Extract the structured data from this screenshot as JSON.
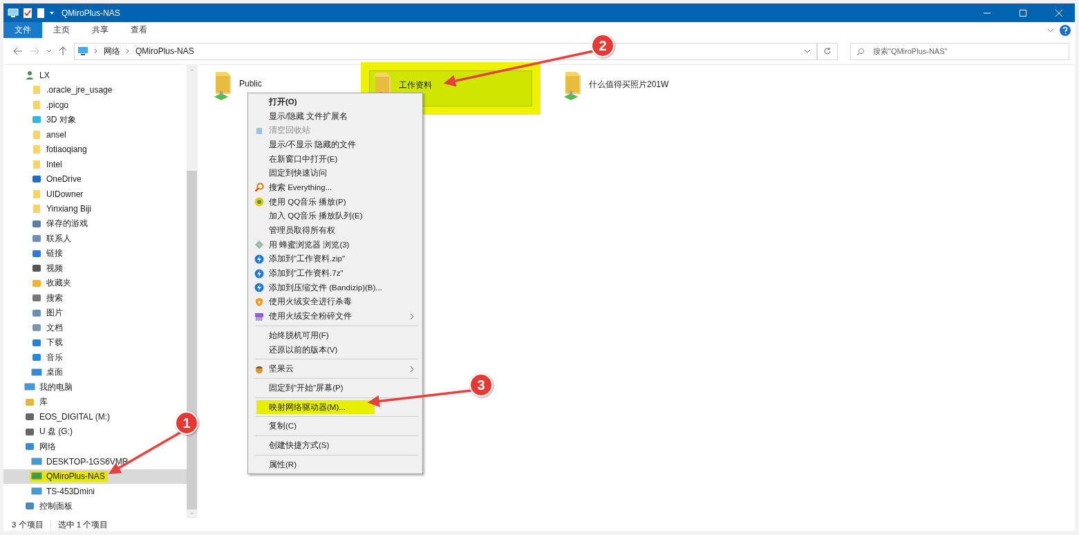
{
  "window": {
    "title": "QMiroPlus-NAS"
  },
  "ribbon_tabs": [
    {
      "label": "文件",
      "selected": true
    },
    {
      "label": "主页",
      "selected": false
    },
    {
      "label": "共享",
      "selected": false
    },
    {
      "label": "查看",
      "selected": false
    }
  ],
  "address_bar": {
    "crumbs": [
      "网络",
      "QMiroPlus-NAS"
    ]
  },
  "search": {
    "placeholder": "搜索\"QMiroPlus-NAS\""
  },
  "sidebar": {
    "items": [
      {
        "label": "LX",
        "selected": false,
        "highlighted": false,
        "children": [
          {
            "label": ".oracle_jre_usage",
            "selected": false,
            "highlighted": false
          },
          {
            "label": ".picgo",
            "selected": false,
            "highlighted": false
          },
          {
            "label": "3D 对象",
            "selected": false,
            "highlighted": false
          },
          {
            "label": "ansel",
            "selected": false,
            "highlighted": false
          },
          {
            "label": "fotiaoqiang",
            "selected": false,
            "highlighted": false
          },
          {
            "label": "Intel",
            "selected": false,
            "highlighted": false
          },
          {
            "label": "OneDrive",
            "selected": false,
            "highlighted": false
          },
          {
            "label": "UIDowner",
            "selected": false,
            "highlighted": false
          },
          {
            "label": "Yinxiang Biji",
            "selected": false,
            "highlighted": false
          },
          {
            "label": "保存的游戏",
            "selected": false,
            "highlighted": false
          },
          {
            "label": "联系人",
            "selected": false,
            "highlighted": false
          },
          {
            "label": "链接",
            "selected": false,
            "highlighted": false
          },
          {
            "label": "视频",
            "selected": false,
            "highlighted": false
          },
          {
            "label": "收藏夹",
            "selected": false,
            "highlighted": false
          },
          {
            "label": "搜索",
            "selected": false,
            "highlighted": false
          },
          {
            "label": "图片",
            "selected": false,
            "highlighted": false
          },
          {
            "label": "文档",
            "selected": false,
            "highlighted": false
          },
          {
            "label": "下载",
            "selected": false,
            "highlighted": false
          },
          {
            "label": "音乐",
            "selected": false,
            "highlighted": false
          },
          {
            "label": "桌面",
            "selected": false,
            "highlighted": false
          }
        ]
      },
      {
        "label": "我的电脑",
        "selected": false,
        "highlighted": false
      },
      {
        "label": "库",
        "selected": false,
        "highlighted": false
      },
      {
        "label": "EOS_DIGITAL (M:)",
        "selected": false,
        "highlighted": false
      },
      {
        "label": "U 盘 (G:)",
        "selected": false,
        "highlighted": false
      },
      {
        "label": "网络",
        "selected": false,
        "highlighted": false,
        "children": [
          {
            "label": "DESKTOP-1GS6VMR",
            "selected": false,
            "highlighted": false
          },
          {
            "label": "QMiroPlus-NAS",
            "selected": true,
            "highlighted": true
          },
          {
            "label": "TS-453Dmini",
            "selected": false,
            "highlighted": false
          }
        ]
      },
      {
        "label": "控制面板",
        "selected": false,
        "highlighted": false
      }
    ]
  },
  "folders": [
    {
      "name": "Public",
      "selected": false
    },
    {
      "name": "工作资料",
      "selected": true
    },
    {
      "name": "什么值得买照片201W",
      "selected": false
    }
  ],
  "context_menu": [
    {
      "kind": "item",
      "label": "打开(O)",
      "bold": true,
      "disabled": false,
      "submenu": false,
      "highlighted": false
    },
    {
      "kind": "item",
      "label": "显示/隐藏 文件扩展名",
      "bold": false,
      "disabled": false,
      "submenu": false,
      "highlighted": false
    },
    {
      "kind": "item",
      "label": "清空回收站",
      "bold": false,
      "disabled": true,
      "submenu": false,
      "highlighted": false
    },
    {
      "kind": "item",
      "label": "显示/不显示 隐藏的文件",
      "bold": false,
      "disabled": false,
      "submenu": false,
      "highlighted": false
    },
    {
      "kind": "item",
      "label": "在新窗口中打开(E)",
      "bold": false,
      "disabled": false,
      "submenu": false,
      "highlighted": false
    },
    {
      "kind": "item",
      "label": "固定到快速访问",
      "bold": false,
      "disabled": false,
      "submenu": false,
      "highlighted": false
    },
    {
      "kind": "item",
      "label": "搜索 Everything...",
      "bold": false,
      "disabled": false,
      "submenu": false,
      "highlighted": false
    },
    {
      "kind": "item",
      "label": "使用 QQ音乐 播放(P)",
      "bold": false,
      "disabled": false,
      "submenu": false,
      "highlighted": false
    },
    {
      "kind": "item",
      "label": "加入 QQ音乐 播放队列(E)",
      "bold": false,
      "disabled": false,
      "submenu": false,
      "highlighted": false
    },
    {
      "kind": "item",
      "label": "管理员取得所有权",
      "bold": false,
      "disabled": false,
      "submenu": false,
      "highlighted": false
    },
    {
      "kind": "item",
      "label": "用 蜂蜜浏览器 浏览(3)",
      "bold": false,
      "disabled": false,
      "submenu": false,
      "highlighted": false
    },
    {
      "kind": "item",
      "label": "添加到\"工作资料.zip\"",
      "bold": false,
      "disabled": false,
      "submenu": false,
      "highlighted": false
    },
    {
      "kind": "item",
      "label": "添加到\"工作资料.7z\"",
      "bold": false,
      "disabled": false,
      "submenu": false,
      "highlighted": false
    },
    {
      "kind": "item",
      "label": "添加到压缩文件 (Bandizip)(B)...",
      "bold": false,
      "disabled": false,
      "submenu": false,
      "highlighted": false
    },
    {
      "kind": "item",
      "label": "使用火绒安全进行杀毒",
      "bold": false,
      "disabled": false,
      "submenu": false,
      "highlighted": false
    },
    {
      "kind": "item",
      "label": "使用火绒安全粉碎文件",
      "bold": false,
      "disabled": false,
      "submenu": true,
      "highlighted": false
    },
    {
      "kind": "separator"
    },
    {
      "kind": "item",
      "label": "始终脱机可用(F)",
      "bold": false,
      "disabled": false,
      "submenu": false,
      "highlighted": false
    },
    {
      "kind": "item",
      "label": "还原以前的版本(V)",
      "bold": false,
      "disabled": false,
      "submenu": false,
      "highlighted": false
    },
    {
      "kind": "separator"
    },
    {
      "kind": "item",
      "label": "坚果云",
      "bold": false,
      "disabled": false,
      "submenu": true,
      "highlighted": false
    },
    {
      "kind": "separator"
    },
    {
      "kind": "item",
      "label": "固定到\"开始\"屏幕(P)",
      "bold": false,
      "disabled": false,
      "submenu": false,
      "highlighted": false
    },
    {
      "kind": "separator"
    },
    {
      "kind": "item",
      "label": "映射网络驱动器(M)...",
      "bold": false,
      "disabled": false,
      "submenu": false,
      "highlighted": true
    },
    {
      "kind": "separator"
    },
    {
      "kind": "item",
      "label": "复制(C)",
      "bold": false,
      "disabled": false,
      "submenu": false,
      "highlighted": false
    },
    {
      "kind": "separator"
    },
    {
      "kind": "item",
      "label": "创建快捷方式(S)",
      "bold": false,
      "disabled": false,
      "submenu": false,
      "highlighted": false
    },
    {
      "kind": "separator"
    },
    {
      "kind": "item",
      "label": "属性(R)",
      "bold": false,
      "disabled": false,
      "submenu": false,
      "highlighted": false
    }
  ],
  "annotations": [
    {
      "number": "1"
    },
    {
      "number": "2"
    },
    {
      "number": "3"
    }
  ],
  "status_bar": {
    "count": "3 个项目",
    "selection": "选中 1 个项目"
  }
}
